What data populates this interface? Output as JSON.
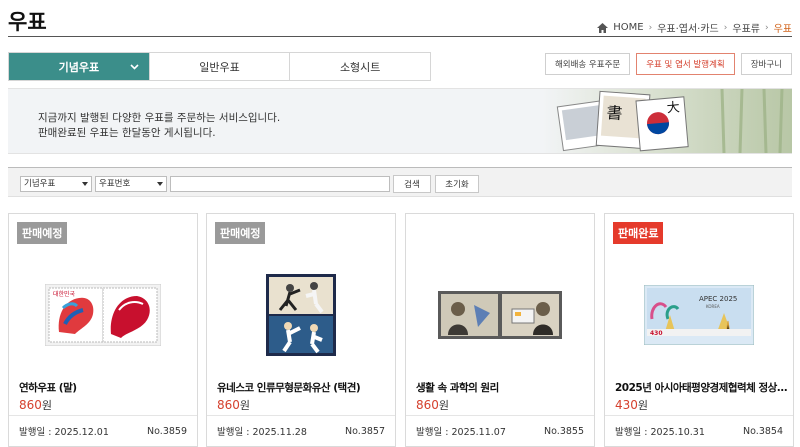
{
  "page": {
    "title": "우표"
  },
  "breadcrumb": {
    "home": "HOME",
    "level1": "우표·엽서·카드",
    "level2": "우표류",
    "current": "우표"
  },
  "tabs": [
    {
      "label": "기념우표",
      "active": true
    },
    {
      "label": "일반우표",
      "active": false
    },
    {
      "label": "소형시트",
      "active": false
    }
  ],
  "top_buttons": {
    "overseas": "해외배송 우표주문",
    "plan": "우표 및 엽서 발행계획",
    "cart": "장바구니"
  },
  "banner": {
    "line1": "지금까지 발행된 다양한 우표를 주문하는 서비스입니다.",
    "line2": "판매완료된 우표는 한달동안 게시됩니다."
  },
  "search": {
    "category": "기념우표",
    "field": "우표번호",
    "query": "",
    "search_label": "검색",
    "reset_label": "초기화"
  },
  "cards": [
    {
      "status": "판매예정",
      "name": "연하우표 (말)",
      "price": "860",
      "unit": "원",
      "date_label": "발행일 :",
      "date": "2025.12.01",
      "number": "No.3859"
    },
    {
      "status": "판매예정",
      "name": "유네스코 인류무형문화유산 (택견)",
      "price": "860",
      "unit": "원",
      "date_label": "발행일 :",
      "date": "2025.11.28",
      "number": "No.3857"
    },
    {
      "status": "",
      "name": "생활 속 과학의 원리",
      "price": "860",
      "unit": "원",
      "date_label": "발행일 :",
      "date": "2025.11.07",
      "number": "No.3855"
    },
    {
      "status": "판매완료",
      "name": "2025년 아시아태평양경제협력체 정상...",
      "price": "430",
      "unit": "원",
      "date_label": "발행일 :",
      "date": "2025.10.31",
      "number": "No.3854"
    }
  ],
  "stamp_text": {
    "apec": "APEC 2025",
    "korea": "KOREA",
    "denom": "430"
  },
  "colors": {
    "accent": "#3b8e8a",
    "price": "#d5402d",
    "badge_gray": "#9a9a9a",
    "badge_red": "#e53a2b",
    "breadcrumb_current": "#d1631a"
  }
}
